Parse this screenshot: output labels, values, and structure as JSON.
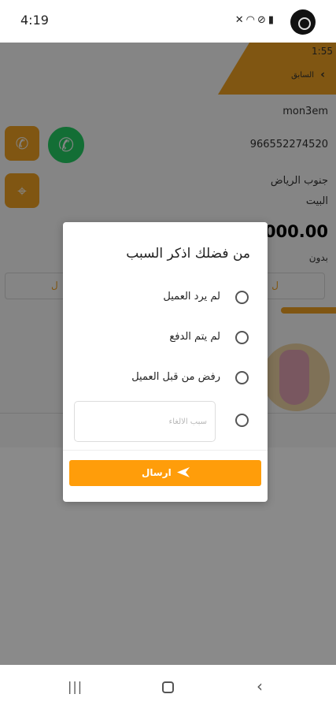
{
  "status_bar": {
    "time": "4:19",
    "icons": [
      "mute-icon",
      "wifi-icon",
      "dnd-icon",
      "battery-icon"
    ]
  },
  "header": {
    "time": "1:55",
    "back_label": "السابق"
  },
  "customer": {
    "name": "mon3em",
    "phone": "966552274520",
    "area": "جنوب الرياض",
    "place": "البيت",
    "total": "1,000.00",
    "note": "بدون"
  },
  "dialog": {
    "title": "من فضلك اذكر السبب",
    "options": [
      {
        "label": "لم يرد العميل"
      },
      {
        "label": "لم يتم الدفع"
      },
      {
        "label": "رفض من قبل العميل"
      }
    ],
    "reason_placeholder": "سبب الالغاء",
    "reason_value": "",
    "send_label": "ارسال"
  },
  "colors": {
    "accent": "#f5a623",
    "button": "#ff9d0a",
    "whatsapp": "#25d366"
  }
}
